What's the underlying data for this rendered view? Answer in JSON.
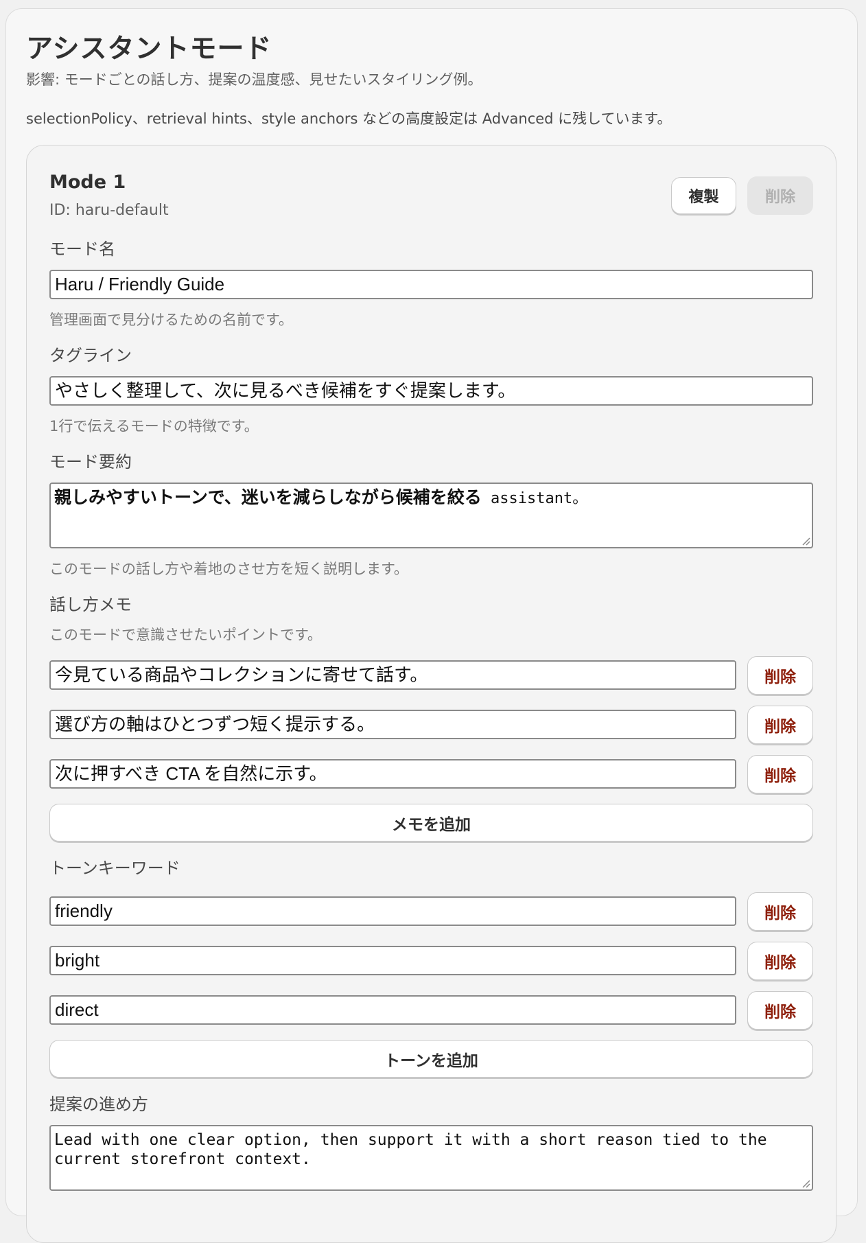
{
  "header": {
    "title": "アシスタントモード",
    "subtitle": "影響: モードごとの話し方、提案の温度感、見せたいスタイリング例。",
    "note": "selectionPolicy、retrieval hints、style anchors などの高度設定は Advanced に残しています。"
  },
  "mode": {
    "title": "Mode 1",
    "id_text": "ID: haru-default",
    "duplicate_label": "複製",
    "delete_label": "削除",
    "name": {
      "label": "モード名",
      "value": "Haru / Friendly Guide",
      "help": "管理画面で見分けるための名前です。"
    },
    "tagline": {
      "label": "タグライン",
      "value": "やさしく整理して、次に見るべき候補をすぐ提案します。",
      "help": "1行で伝えるモードの特徴です。"
    },
    "summary": {
      "label": "モード要約",
      "value_jp": "親しみやすいトーンで、迷いを減らしながら候補を絞る",
      "value_en": " assistant。",
      "help": "このモードの話し方や着地のさせ方を短く説明します。"
    },
    "memos": {
      "label": "話し方メモ",
      "help": "このモードで意識させたいポイントです。",
      "items": [
        "今見ている商品やコレクションに寄せて話す。",
        "選び方の軸はひとつずつ短く提示する。",
        "次に押すべき CTA を自然に示す。"
      ],
      "delete_label": "削除",
      "add_label": "メモを追加"
    },
    "tones": {
      "label": "トーンキーワード",
      "items": [
        "friendly",
        "bright",
        "direct"
      ],
      "delete_label": "削除",
      "add_label": "トーンを追加"
    },
    "proposal": {
      "label": "提案の進め方",
      "value": "Lead with one clear option, then support it with a short reason tied to the\ncurrent storefront context."
    }
  },
  "colors": {
    "danger": "#8e1f0b",
    "disabled_text": "#b0b0b0"
  }
}
